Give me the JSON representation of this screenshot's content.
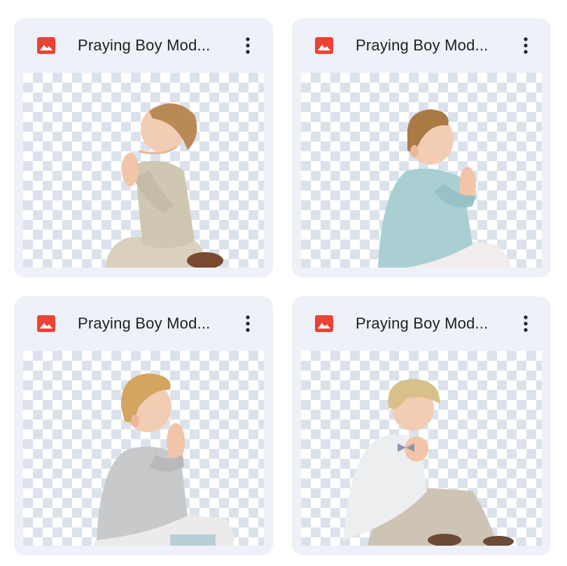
{
  "files": [
    {
      "title": "Praying Boy Mod...",
      "icon": "image-file-icon",
      "more_icon": "more-vert-icon",
      "suit_color": "#cfc7b2",
      "hair_color": "#b88a55"
    },
    {
      "title": "Praying Boy Mod...",
      "icon": "image-file-icon",
      "more_icon": "more-vert-icon",
      "suit_color": "#a9cfd3",
      "hair_color": "#a97a44"
    },
    {
      "title": "Praying Boy Mod...",
      "icon": "image-file-icon",
      "more_icon": "more-vert-icon",
      "suit_color": "#c8c9cb",
      "hair_color": "#d4a560"
    },
    {
      "title": "Praying Boy Mod...",
      "icon": "image-file-icon",
      "more_icon": "more-vert-icon",
      "suit_color": "#eceef0",
      "hair_color": "#d8c08a"
    }
  ],
  "colors": {
    "card_background": "#eef1f7",
    "icon_red": "#ea4335",
    "title_text": "#1f1f1f"
  }
}
